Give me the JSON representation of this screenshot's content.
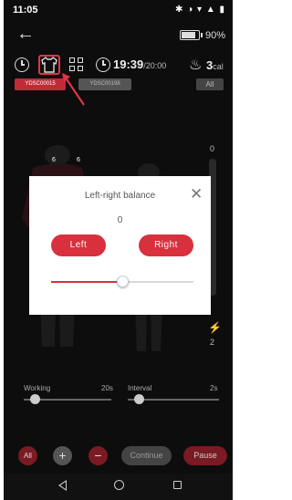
{
  "status": {
    "time": "11:05",
    "icons": "✱ ◑ ▾ ▲ ▮"
  },
  "header": {
    "battery_pct": "90%",
    "battery_level": 0.9
  },
  "session": {
    "timer": "19:39",
    "timer_total": "/20:00",
    "calories": "3",
    "calories_unit": "cal"
  },
  "devices": {
    "items": [
      "YDSC00015",
      "YDSC00198"
    ],
    "all_label": "All"
  },
  "figure_numbers": [
    "6",
    "6"
  ],
  "intensity": {
    "top": "0",
    "bottom": "2"
  },
  "dialog": {
    "title": "Left-right balance",
    "value": "0",
    "left_label": "Left",
    "right_label": "Right",
    "balance_level": 0.5
  },
  "sliders": {
    "working": {
      "label": "Working",
      "value": "20s",
      "level": 0.12
    },
    "interval": {
      "label": "Interval",
      "value": "2s",
      "level": 0.12
    }
  },
  "controls": {
    "all": "All",
    "plus": "+",
    "minus": "−",
    "continue": "Continue",
    "pause": "Pause"
  },
  "colors": {
    "accent": "#d8303c",
    "background": "#0d0d0d",
    "highlight_box": "#e03545"
  }
}
